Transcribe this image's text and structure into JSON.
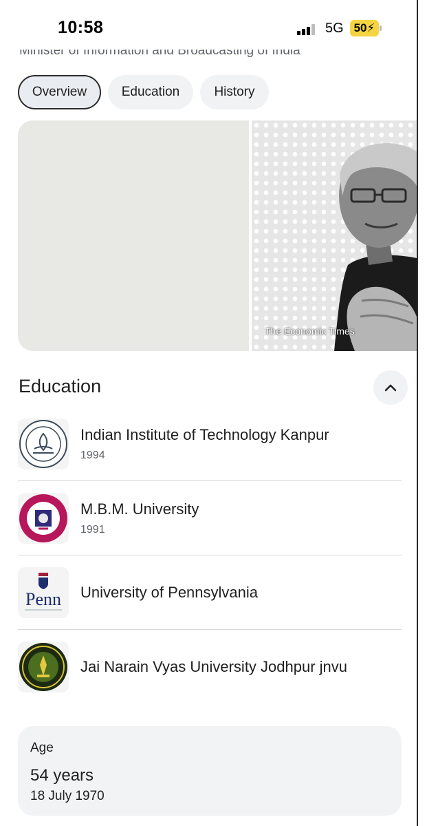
{
  "status_bar": {
    "time": "10:58",
    "network": "5G",
    "battery": "50",
    "icons": [
      "cellular-signal-icon",
      "charging-bolt-icon"
    ]
  },
  "header": {
    "subtitle": "Minister of Information and Broadcasting of India"
  },
  "tabs": [
    {
      "label": "Overview",
      "selected": true
    },
    {
      "label": "Education",
      "selected": false
    },
    {
      "label": "History",
      "selected": false
    }
  ],
  "images": {
    "photo_caption": "The Economic Times"
  },
  "education": {
    "title": "Education",
    "collapse_icon": "chevron-up-icon",
    "items": [
      {
        "name": "Indian Institute of Technology Kanpur",
        "year": "1994",
        "logo": "iit-kanpur-logo"
      },
      {
        "name": "M.B.M. University",
        "year": "1991",
        "logo": "mbm-university-logo"
      },
      {
        "name": "University of Pennsylvania",
        "year": "",
        "logo": "penn-logo",
        "logo_text": "Penn"
      },
      {
        "name": "Jai Narain Vyas University Jodhpur jnvu",
        "year": "",
        "logo": "jnvu-logo"
      }
    ]
  },
  "age": {
    "label": "Age",
    "value": "54 years",
    "birth_date": "18 July 1970"
  },
  "colors": {
    "tab_active_border": "#2b2b2b",
    "tab_bg": "#f0f2f4",
    "card_bg": "#f2f3f5",
    "battery": "#f4d541",
    "secondary_text": "#5f6368"
  }
}
